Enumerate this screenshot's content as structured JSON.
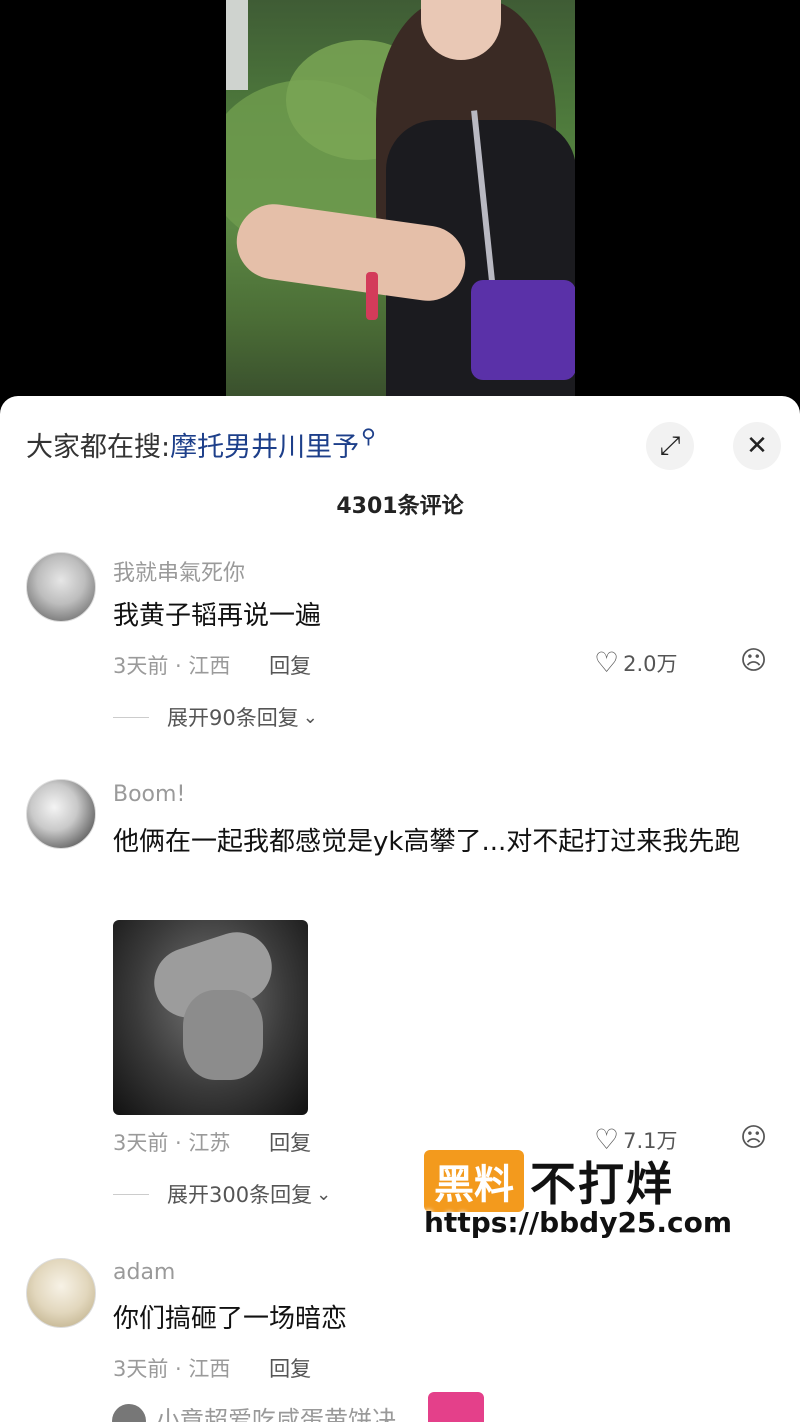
{
  "search": {
    "prefix": "大家都在搜:",
    "term": "摩托男井川里予",
    "search_icon": "search-icon"
  },
  "header": {
    "comment_count": "4301条评论",
    "expand_icon": "expand-icon",
    "close_icon": "close-icon"
  },
  "comments": [
    {
      "username": "我就串氣死你",
      "text": "我黄子韬再说一遍",
      "time_location": "3天前 · 江西",
      "reply_label": "回复",
      "likes": "2.0万",
      "expand_label": "展开90条回复"
    },
    {
      "username": "Boom!",
      "text": "他俩在一起我都感觉是yk高攀了...对不起打过来我先跑",
      "time_location": "3天前 · 江苏",
      "reply_label": "回复",
      "likes": "7.1万",
      "expand_label": "展开300条回复"
    },
    {
      "username": "adam",
      "text": "你们搞砸了一场暗恋",
      "time_location": "3天前 · 江西",
      "reply_label": "回复"
    }
  ],
  "partial_next": "小竟超爱吃咸蛋黄饼决",
  "watermark": {
    "badge": "黑料",
    "rest": "不打烊",
    "url": "https://bbdy25.com"
  }
}
